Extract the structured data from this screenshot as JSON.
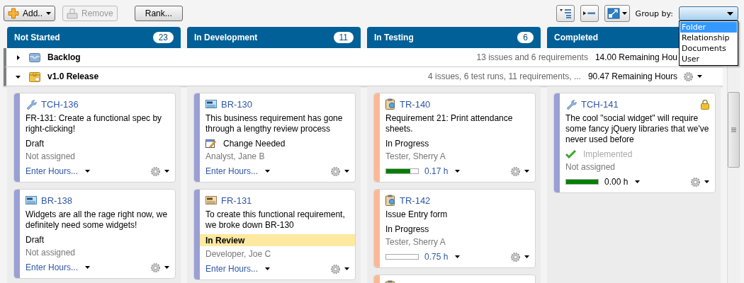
{
  "toolbar": {
    "buttons": [
      {
        "label": "Add..",
        "kind": "add",
        "disabled": false,
        "menu": true
      },
      {
        "label": "Remove",
        "kind": "remove",
        "disabled": true,
        "menu": false
      },
      {
        "label": "Rank...",
        "kind": "plain",
        "disabled": false,
        "menu": false
      }
    ],
    "group_by": {
      "label": "Group by:",
      "expanded": true,
      "options": [
        {
          "label": "Folder",
          "selected": true
        },
        {
          "label": "Relationship",
          "selected": false
        },
        {
          "label": "Documents",
          "selected": false
        },
        {
          "label": "User",
          "selected": false
        }
      ]
    }
  },
  "columns": [
    {
      "title": "Not Started",
      "count": "23",
      "cards": [
        {
          "kind": "task",
          "color": "#9a9fd4",
          "id": "TCH-136",
          "title": "FR-131: Create a functional spec by right-clicking!",
          "status": {
            "kind": "plain",
            "text": "Draft"
          },
          "owner": "Not assigned",
          "locked": false,
          "footer": {
            "kind": "hours",
            "text": "Enter Hours..."
          }
        },
        {
          "kind": "business",
          "color": "#9a9fd4",
          "id": "BR-138",
          "title": "Widgets are all the rage right now, we definitely need some widgets!",
          "status": {
            "kind": "plain",
            "text": "Draft"
          },
          "owner": "Not assigned",
          "locked": false,
          "footer": {
            "kind": "hours",
            "text": "Enter Hours..."
          }
        }
      ]
    },
    {
      "title": "In Development",
      "count": "11",
      "cards": [
        {
          "kind": "business",
          "color": "#9a9fd4",
          "id": "BR-130",
          "title": "This business requirement has gone through a lengthy review process",
          "status": {
            "kind": "flag",
            "text": "Change Needed"
          },
          "owner": "Analyst, Jane B",
          "locked": false,
          "footer": {
            "kind": "hours",
            "text": "Enter Hours..."
          }
        },
        {
          "kind": "functional",
          "color": "#9a9fd4",
          "id": "FR-131",
          "title": "To create this functional requirement, we broke down BR-130",
          "status": {
            "kind": "highlight",
            "text": "In Review"
          },
          "owner": "Developer, Joe C",
          "locked": false,
          "footer": {
            "kind": "hours",
            "text": "Enter Hours..."
          }
        }
      ]
    },
    {
      "title": "In Testing",
      "count": "6",
      "cards": [
        {
          "kind": "test",
          "color": "#fcb896",
          "id": "TR-140",
          "title": "Requirement 21: Print attendance sheets.",
          "status": {
            "kind": "plain",
            "text": "In Progress"
          },
          "owner": "Tester, Sherry A",
          "locked": false,
          "footer": {
            "kind": "progress",
            "level": 0.75,
            "reading": "0.17 h",
            "link": true
          }
        },
        {
          "kind": "test",
          "color": "#fcb896",
          "id": "TR-142",
          "title": "Issue Entry form",
          "status": {
            "kind": "plain",
            "text": "In Progress"
          },
          "owner": "Tester, Sherry A",
          "locked": false,
          "footer": {
            "kind": "progress",
            "level": 0,
            "reading": "0.75 h",
            "link": true
          }
        },
        {
          "kind": "test",
          "color": "#fcb896"
        }
      ]
    },
    {
      "title": "Completed",
      "cards": [
        {
          "kind": "task",
          "color": "#9a9fd4",
          "id": "TCH-141",
          "title": "The cool \"social widget\" will require some fancy jQuery libraries that we've never used before",
          "status": {
            "kind": "done",
            "text": "Implemented"
          },
          "owner": "Not assigned",
          "locked": true,
          "footer": {
            "kind": "progress",
            "level": 1,
            "reading": "0.00 h",
            "link": false
          }
        }
      ]
    }
  ],
  "lanes": [
    {
      "kind": "backlog",
      "name": "Backlog",
      "expanded": false,
      "summary": "13 issues and 6 requirements",
      "remaining": "14.00 Remaining Hou"
    },
    {
      "kind": "release",
      "name": "v1.0 Release",
      "expanded": true,
      "summary": "4 issues, 6 test runs, 11 requirements, ...",
      "remaining": "90.47 Remaining Hours",
      "actions": true
    }
  ]
}
